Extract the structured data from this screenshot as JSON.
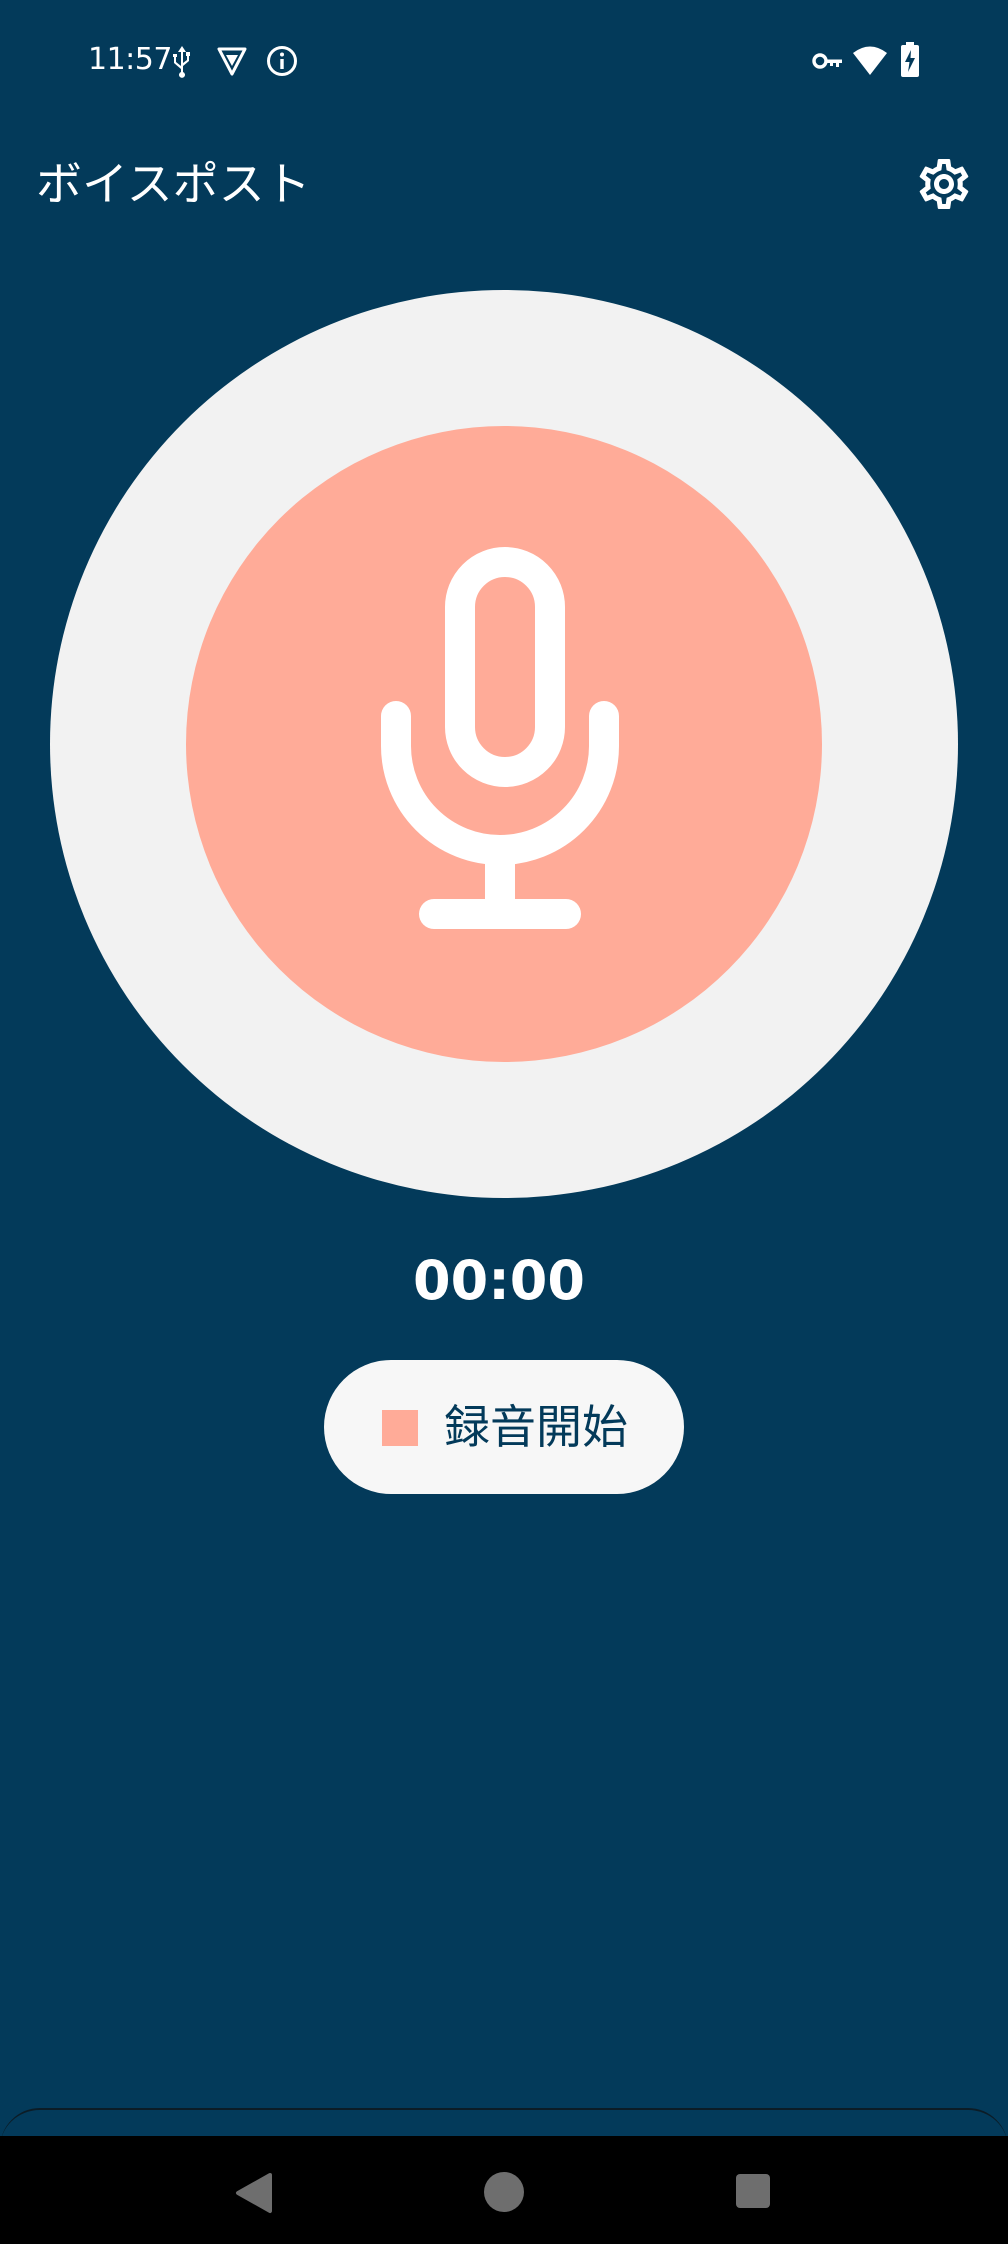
{
  "status_bar": {
    "time": "11:57",
    "left_icons": [
      "usb-icon",
      "vpn-shield-icon",
      "info-icon"
    ],
    "right_icons": [
      "key-icon",
      "wifi-icon",
      "battery-charging-icon"
    ]
  },
  "app_bar": {
    "title": "ボイスポスト",
    "settings_icon": "gear-icon"
  },
  "recorder": {
    "mic_icon": "microphone-icon",
    "timer": "00:00",
    "toggle_label": "録音開始",
    "toggle_icon": "stop-square-icon"
  },
  "colors": {
    "background": "#033a5a",
    "accent": "#ffab98",
    "outer_ring": "#f2f2f2",
    "button_bg": "#f7f7f7"
  },
  "nav_bar": {
    "buttons": [
      "back",
      "home",
      "recents"
    ]
  }
}
